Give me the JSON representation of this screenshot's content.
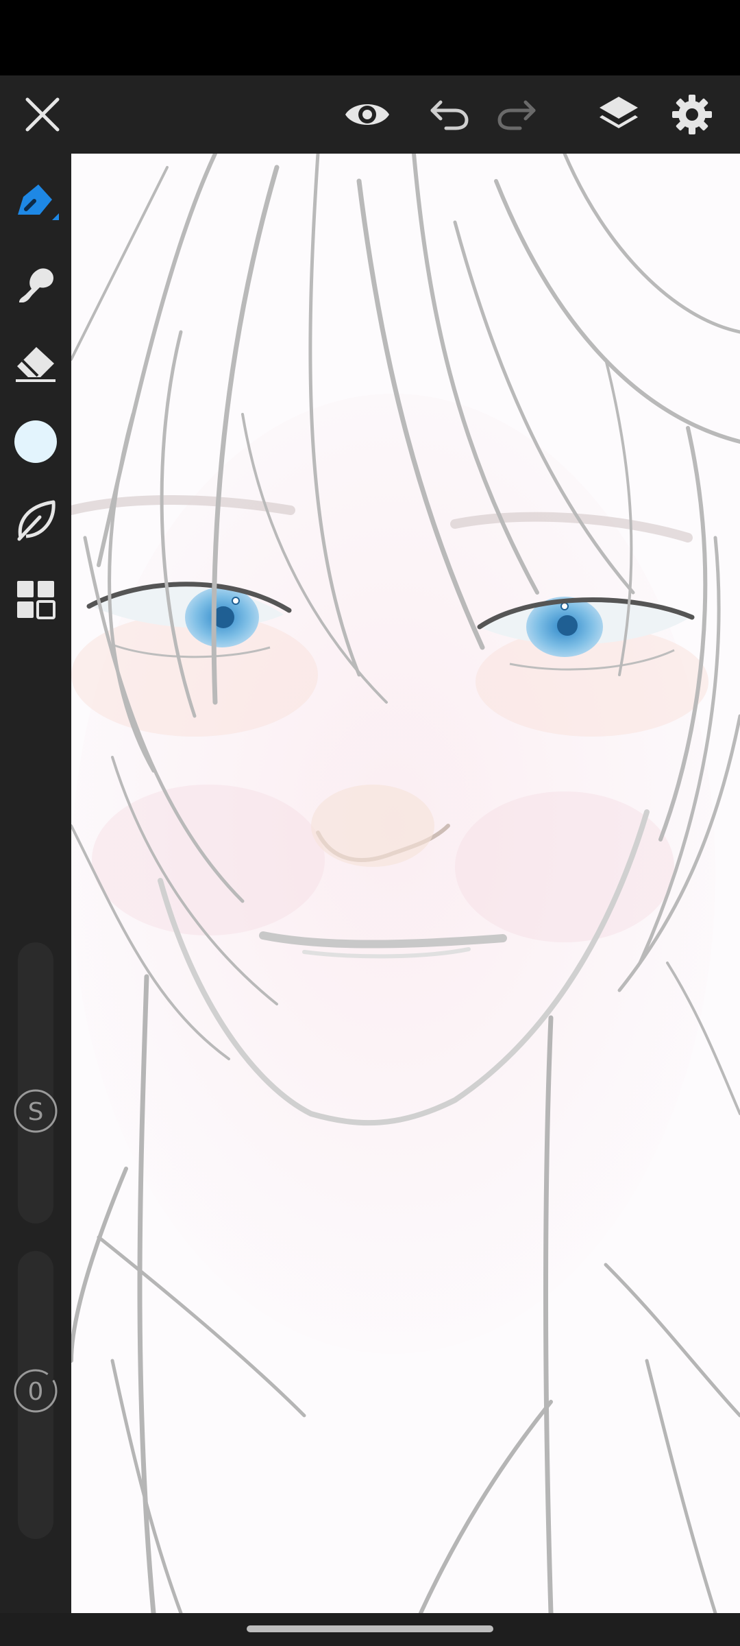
{
  "app": {
    "colors": {
      "toolbar_bg": "#222222",
      "icon": "#e6e6e6",
      "icon_disabled": "#6a6a6a",
      "accent": "#1e88e5",
      "current_color": "#e3f4fd"
    },
    "toolbar": {
      "close_icon": "close-icon",
      "preview_icon": "eye-icon",
      "undo_icon": "undo-icon",
      "redo_icon": "redo-icon",
      "layers_icon": "layers-icon",
      "settings_icon": "gear-icon"
    },
    "sidebar": {
      "tools": [
        "brush-tool",
        "smudge-tool",
        "eraser-tool",
        "color-swatch",
        "leaf-tool",
        "grid-tool"
      ],
      "size_badge": "S",
      "opacity_badge": "0"
    }
  }
}
